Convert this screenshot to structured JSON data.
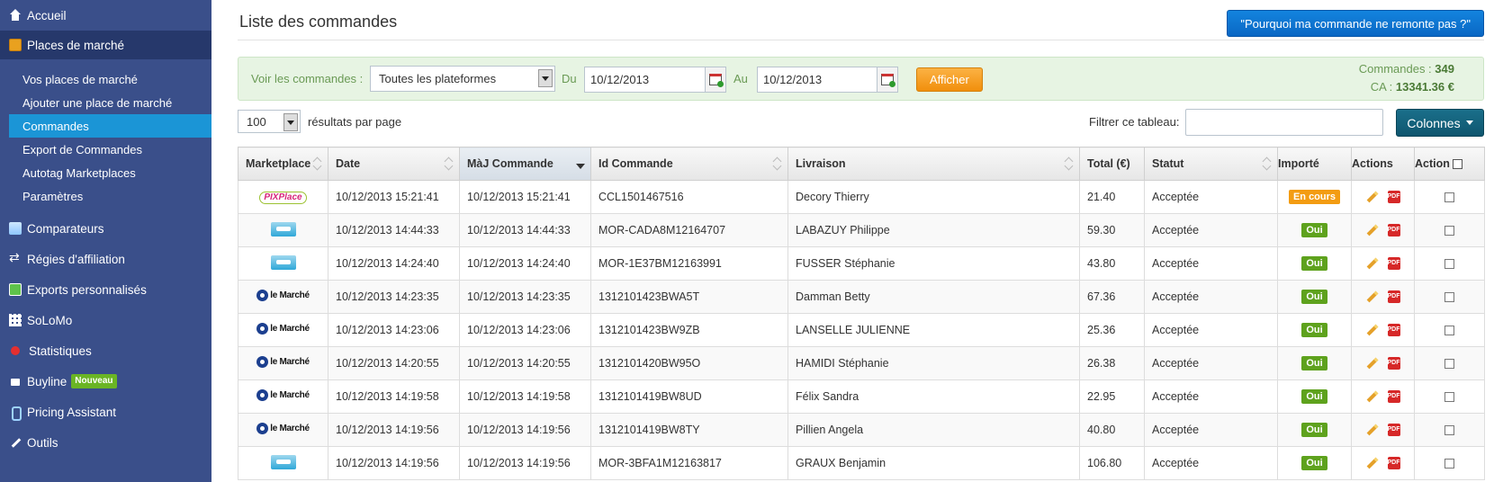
{
  "sidebar": {
    "accueil": "Accueil",
    "places": "Places de marché",
    "sub": [
      {
        "label": "Vos places de marché"
      },
      {
        "label": "Ajouter une place de marché"
      },
      {
        "label": "Commandes"
      },
      {
        "label": "Export de Commandes"
      },
      {
        "label": "Autotag Marketplaces"
      },
      {
        "label": "Paramètres"
      }
    ],
    "comparateurs": "Comparateurs",
    "regies": "Régies d'affiliation",
    "exports": "Exports personnalisés",
    "solomo": "SoLoMo",
    "statistiques": "Statistiques",
    "buyline": "Buyline",
    "buyline_badge": "Nouveau",
    "pricing": "Pricing Assistant",
    "outils": "Outils"
  },
  "header": {
    "title": "Liste des commandes",
    "why_button": "\"Pourquoi ma commande ne remonte pas ?\""
  },
  "filters": {
    "voir_label": "Voir les commandes :",
    "platform": "Toutes les plateformes",
    "du_label": "Du",
    "date_from": "10/12/2013",
    "au_label": "Au",
    "date_to": "10/12/2013",
    "afficher": "Afficher",
    "commandes_label": "Commandes :",
    "commandes_value": "349",
    "ca_label": "CA :",
    "ca_value": "13341.36 €"
  },
  "table_controls": {
    "per_page": "100",
    "per_page_label": "résultats par page",
    "filter_label": "Filtrer ce tableau:",
    "filter_value": "",
    "colonnes": "Colonnes"
  },
  "table": {
    "headers": {
      "marketplace": "Marketplace",
      "date": "Date",
      "maj": "MàJ Commande",
      "id": "Id Commande",
      "livraison": "Livraison",
      "total": "Total (€)",
      "statut": "Statut",
      "importe": "Importé",
      "actions": "Actions",
      "action": "Action"
    },
    "rows": [
      {
        "marketplace": "PIXPlace",
        "logo": "pixplace-logo",
        "date": "10/12/2013 15:21:41",
        "maj": "10/12/2013 15:21:41",
        "id": "CCL1501467516",
        "livraison": "Decory Thierry",
        "total": "21.40",
        "statut": "Acceptée",
        "importe": "En cours",
        "importe_type": "pending"
      },
      {
        "marketplace": "",
        "logo": "rueducommerce-logo",
        "date": "10/12/2013 14:44:33",
        "maj": "10/12/2013 14:44:33",
        "id": "MOR-CADA8M12164707",
        "livraison": "LABAZUY Philippe",
        "total": "59.30",
        "statut": "Acceptée",
        "importe": "Oui",
        "importe_type": "yes"
      },
      {
        "marketplace": "",
        "logo": "rueducommerce-logo",
        "date": "10/12/2013 14:24:40",
        "maj": "10/12/2013 14:24:40",
        "id": "MOR-1E37BM12163991",
        "livraison": "FUSSER Stéphanie",
        "total": "43.80",
        "statut": "Acceptée",
        "importe": "Oui",
        "importe_type": "yes"
      },
      {
        "marketplace": "le Marché",
        "logo": "lemarche-logo",
        "date": "10/12/2013 14:23:35",
        "maj": "10/12/2013 14:23:35",
        "id": "1312101423BWA5T",
        "livraison": "Damman Betty",
        "total": "67.36",
        "statut": "Acceptée",
        "importe": "Oui",
        "importe_type": "yes"
      },
      {
        "marketplace": "le Marché",
        "logo": "lemarche-logo",
        "date": "10/12/2013 14:23:06",
        "maj": "10/12/2013 14:23:06",
        "id": "1312101423BW9ZB",
        "livraison": "LANSELLE JULIENNE",
        "total": "25.36",
        "statut": "Acceptée",
        "importe": "Oui",
        "importe_type": "yes"
      },
      {
        "marketplace": "le Marché",
        "logo": "lemarche-logo",
        "date": "10/12/2013 14:20:55",
        "maj": "10/12/2013 14:20:55",
        "id": "1312101420BW95O",
        "livraison": "HAMIDI Stéphanie",
        "total": "26.38",
        "statut": "Acceptée",
        "importe": "Oui",
        "importe_type": "yes"
      },
      {
        "marketplace": "le Marché",
        "logo": "lemarche-logo",
        "date": "10/12/2013 14:19:58",
        "maj": "10/12/2013 14:19:58",
        "id": "1312101419BW8UD",
        "livraison": "Félix Sandra",
        "total": "22.95",
        "statut": "Acceptée",
        "importe": "Oui",
        "importe_type": "yes"
      },
      {
        "marketplace": "le Marché",
        "logo": "lemarche-logo",
        "date": "10/12/2013 14:19:56",
        "maj": "10/12/2013 14:19:56",
        "id": "1312101419BW8TY",
        "livraison": "Pillien Angela",
        "total": "40.80",
        "statut": "Acceptée",
        "importe": "Oui",
        "importe_type": "yes"
      },
      {
        "marketplace": "",
        "logo": "rueducommerce-logo",
        "date": "10/12/2013 14:19:56",
        "maj": "10/12/2013 14:19:56",
        "id": "MOR-3BFA1M12163817",
        "livraison": "GRAUX Benjamin",
        "total": "106.80",
        "statut": "Acceptée",
        "importe": "Oui",
        "importe_type": "yes"
      }
    ]
  },
  "colors": {
    "sidebar_bg": "#3a4f8a",
    "sidebar_active": "#1b95d6",
    "primary_button": "#0a67c4",
    "afficher": "#f18f0c",
    "badge_yes": "#5ea21d",
    "badge_pending": "#f39c12"
  }
}
